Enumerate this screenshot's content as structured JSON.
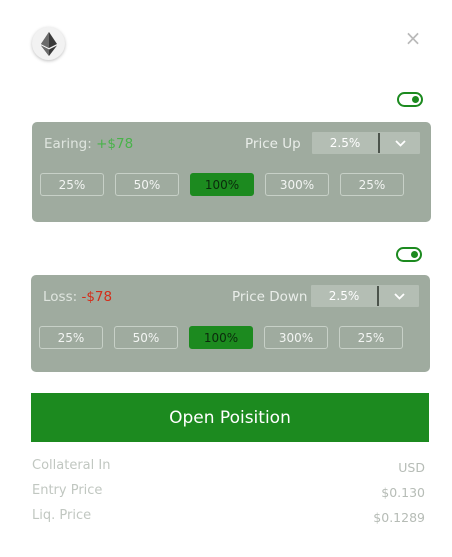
{
  "header": {
    "logo_icon": "ethereum-icon",
    "close_label": "×"
  },
  "earning_card": {
    "label": "Earing:",
    "value": "+$78",
    "price_label": "Price Up",
    "selected": "2.5%",
    "options": [
      "25%",
      "50%",
      "100%",
      "300%",
      "25%"
    ],
    "active_option": "100%"
  },
  "loss_card": {
    "label": "Loss:",
    "value": "-$78",
    "price_label": "Price Down",
    "selected": "2.5%",
    "options": [
      "25%",
      "50%",
      "100%",
      "300%",
      "25%"
    ],
    "active_option": "100%"
  },
  "open_button": "Open Poisition",
  "info": [
    {
      "label": "Collateral In",
      "value": "USD"
    },
    {
      "label": "Entry Price",
      "value": "$0.130"
    },
    {
      "label": "Liq. Price",
      "value": "$0.1289"
    }
  ],
  "colors": {
    "accent": "#1c8a1f",
    "card_bg": "#9fab9f",
    "loss": "#d32e1a",
    "earn": "#49b34a"
  }
}
